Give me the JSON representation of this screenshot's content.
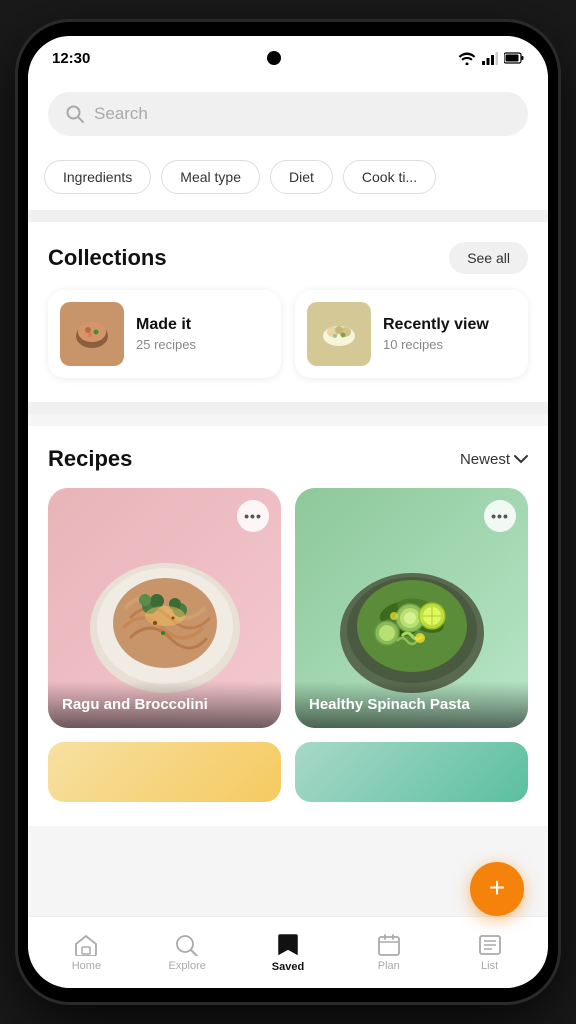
{
  "statusBar": {
    "time": "12:30",
    "wifi": "wifi",
    "signal": "signal",
    "battery": "battery"
  },
  "search": {
    "placeholder": "Search"
  },
  "filters": [
    {
      "id": "ingredients",
      "label": "Ingredients"
    },
    {
      "id": "meal-type",
      "label": "Meal type"
    },
    {
      "id": "diet",
      "label": "Diet"
    },
    {
      "id": "cook-time",
      "label": "Cook ti..."
    }
  ],
  "collections": {
    "title": "Collections",
    "seeAll": "See all",
    "items": [
      {
        "id": "made-it",
        "name": "Made it",
        "count": "25 recipes",
        "emoji": "🍲"
      },
      {
        "id": "recently-viewed",
        "name": "Recently view",
        "count": "10 recipes",
        "emoji": "🥗"
      }
    ]
  },
  "recipes": {
    "title": "Recipes",
    "sortLabel": "Newest",
    "items": [
      {
        "id": "ragu",
        "name": "Ragu and Broccolini",
        "bg": "pink"
      },
      {
        "id": "spinach-pasta",
        "name": "Healthy Spinach Pasta",
        "bg": "green"
      }
    ]
  },
  "fab": {
    "label": "+"
  },
  "bottomNav": [
    {
      "id": "home",
      "label": "Home",
      "icon": "⌂",
      "active": false
    },
    {
      "id": "explore",
      "label": "Explore",
      "icon": "🔍",
      "active": false
    },
    {
      "id": "saved",
      "label": "Saved",
      "icon": "🔖",
      "active": true
    },
    {
      "id": "plan",
      "label": "Plan",
      "icon": "📅",
      "active": false
    },
    {
      "id": "list",
      "label": "List",
      "icon": "📋",
      "active": false
    }
  ]
}
